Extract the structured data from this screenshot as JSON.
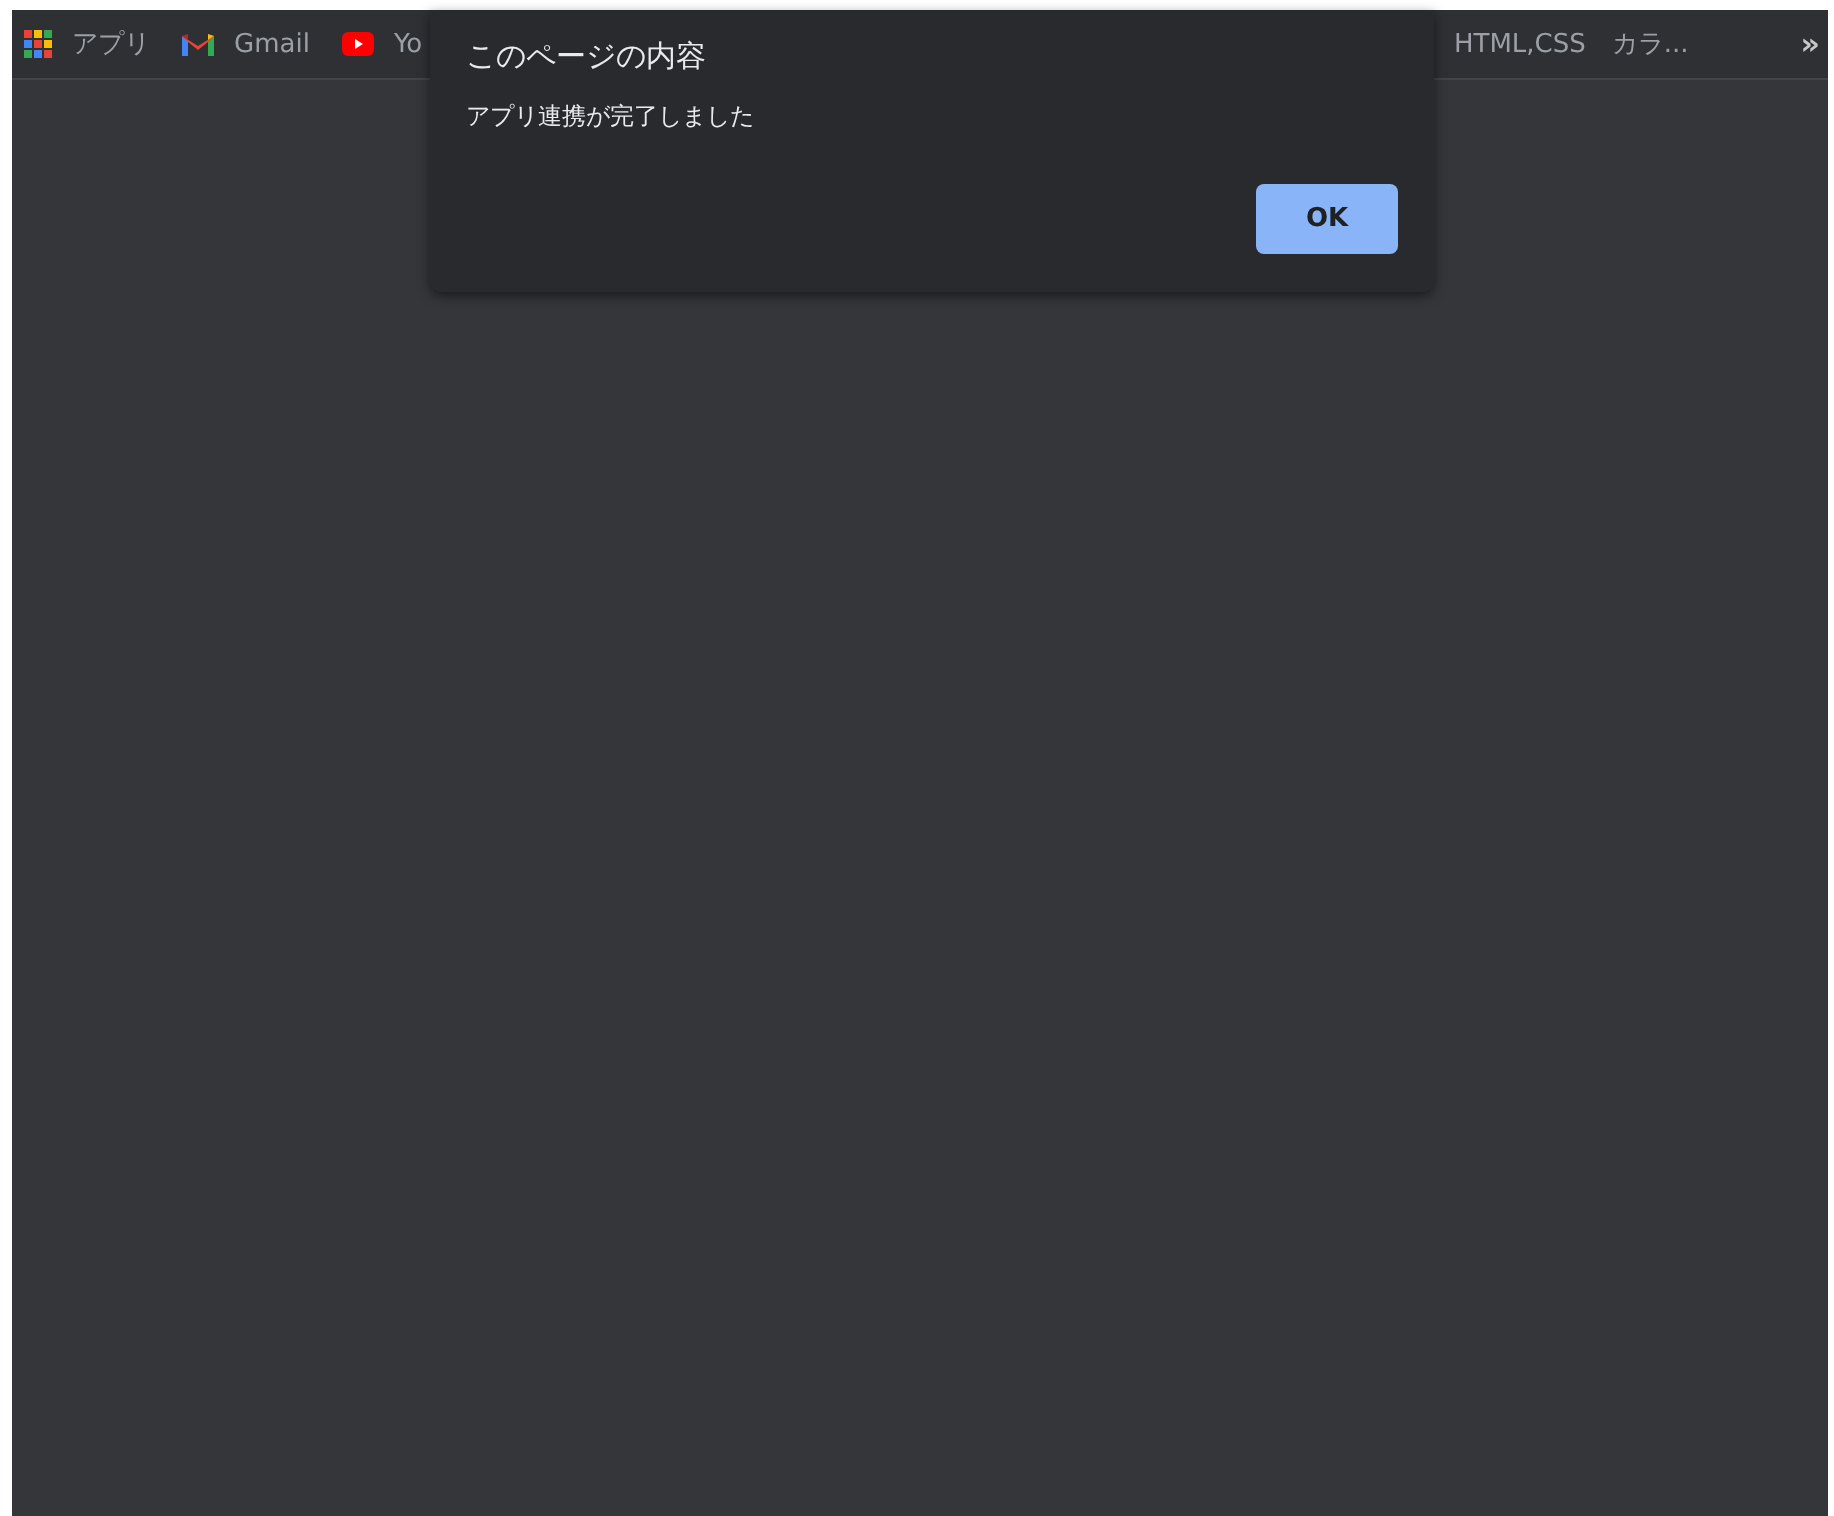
{
  "bookmarks_bar": {
    "items": [
      {
        "kind": "apps",
        "label": "アプリ"
      },
      {
        "kind": "gmail",
        "label": "Gmail"
      },
      {
        "kind": "youtube",
        "label": "Yo"
      },
      {
        "kind": "plain",
        "label": "HTML,CSS　カラ..."
      }
    ],
    "overflow": "»"
  },
  "dialog": {
    "title": "このページの内容",
    "message": "アプリ連携が完了しました",
    "buttons": [
      "OK"
    ]
  }
}
